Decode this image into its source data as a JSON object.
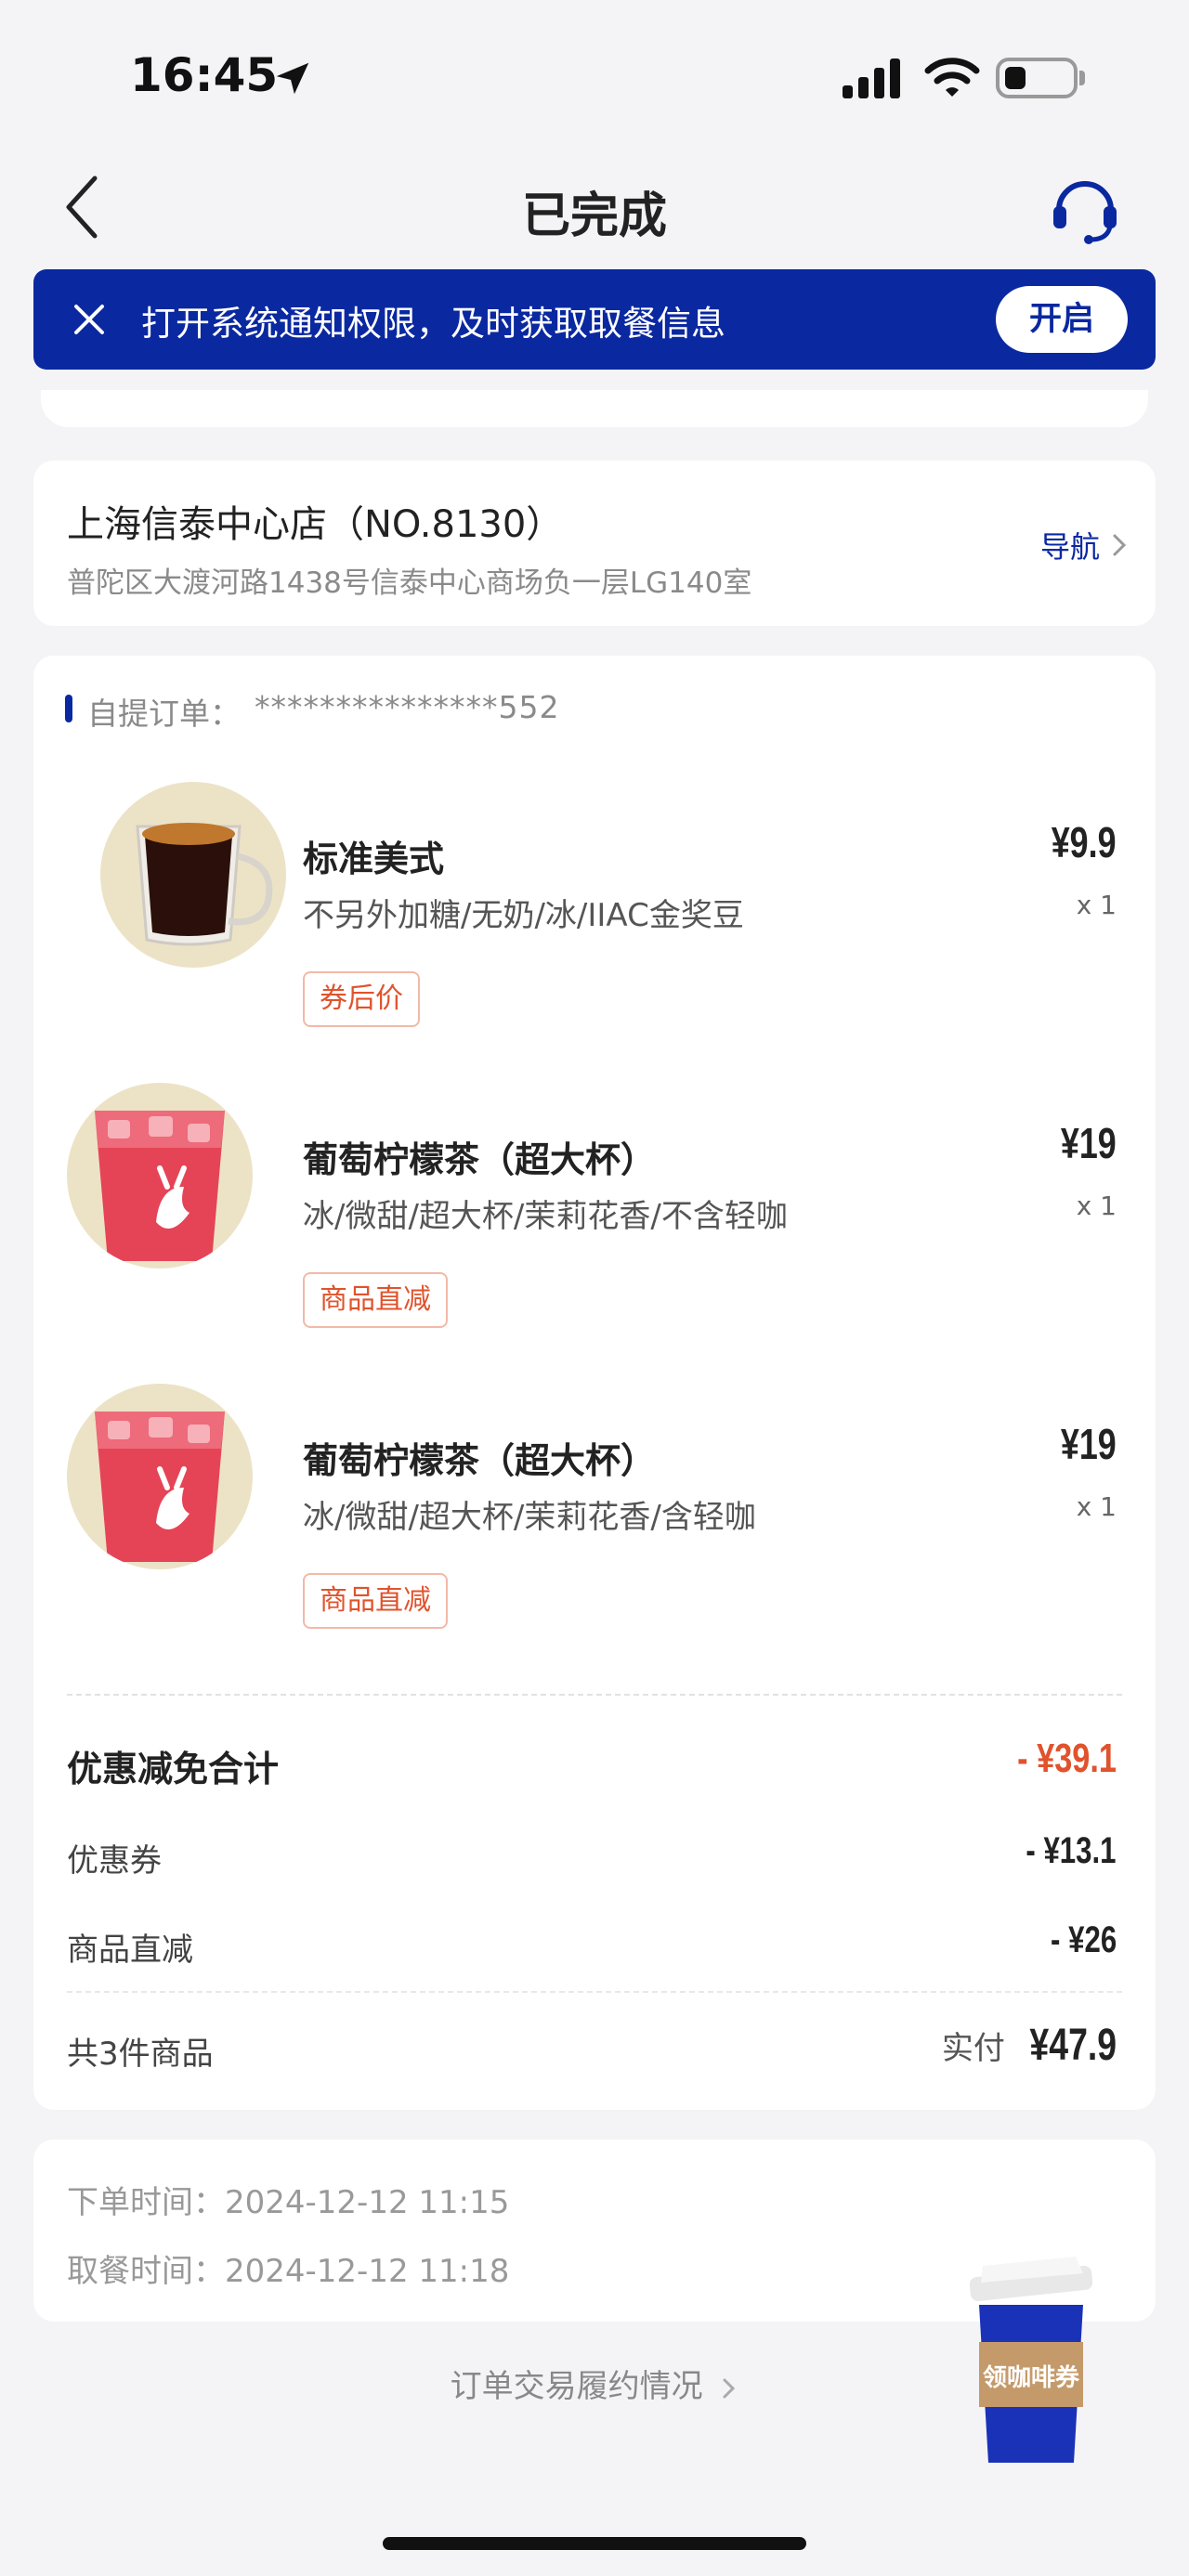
{
  "status_bar": {
    "time": "16:45"
  },
  "nav": {
    "title": "已完成"
  },
  "notice": {
    "text": "打开系统通知权限，及时获取取餐信息",
    "button": "开启"
  },
  "store": {
    "name": "上海信泰中心店（NO.8130）",
    "address": "普陀区大渡河路1438号信泰中心商场负一层LG140室",
    "nav_label": "导航"
  },
  "order": {
    "type_label": "自提订单：",
    "number": "***************552",
    "items": [
      {
        "name": "标准美式",
        "specs": "不另外加糖/无奶/冰/IIAC金奖豆",
        "price": "¥9.9",
        "qty": "x 1",
        "tag": "券后价"
      },
      {
        "name": "葡萄柠檬茶（超大杯）",
        "specs": "冰/微甜/超大杯/茉莉花香/不含轻咖",
        "price": "¥19",
        "qty": "x 1",
        "tag": "商品直减"
      },
      {
        "name": "葡萄柠檬茶（超大杯）",
        "specs": "冰/微甜/超大杯/茉莉花香/含轻咖",
        "price": "¥19",
        "qty": "x 1",
        "tag": "商品直减"
      }
    ],
    "discount_total_label": "优惠减免合计",
    "discount_total": "- ¥39.1",
    "coupon_label": "优惠券",
    "coupon_value": "- ¥13.1",
    "direct_label": "商品直减",
    "direct_value": "- ¥26",
    "count_label": "共3件商品",
    "paid_label": "实付",
    "paid_value": "¥47.9"
  },
  "times": {
    "order_label": "下单时间：",
    "order_time": "2024-12-12 11:15",
    "pickup_label": "取餐时间：",
    "pickup_time": "2024-12-12 11:18"
  },
  "footer": {
    "link": "订单交易履约情况",
    "float_coupon": "领咖啡券"
  },
  "colors": {
    "brand_blue": "#0a28a0",
    "discount_red": "#e0532c"
  }
}
